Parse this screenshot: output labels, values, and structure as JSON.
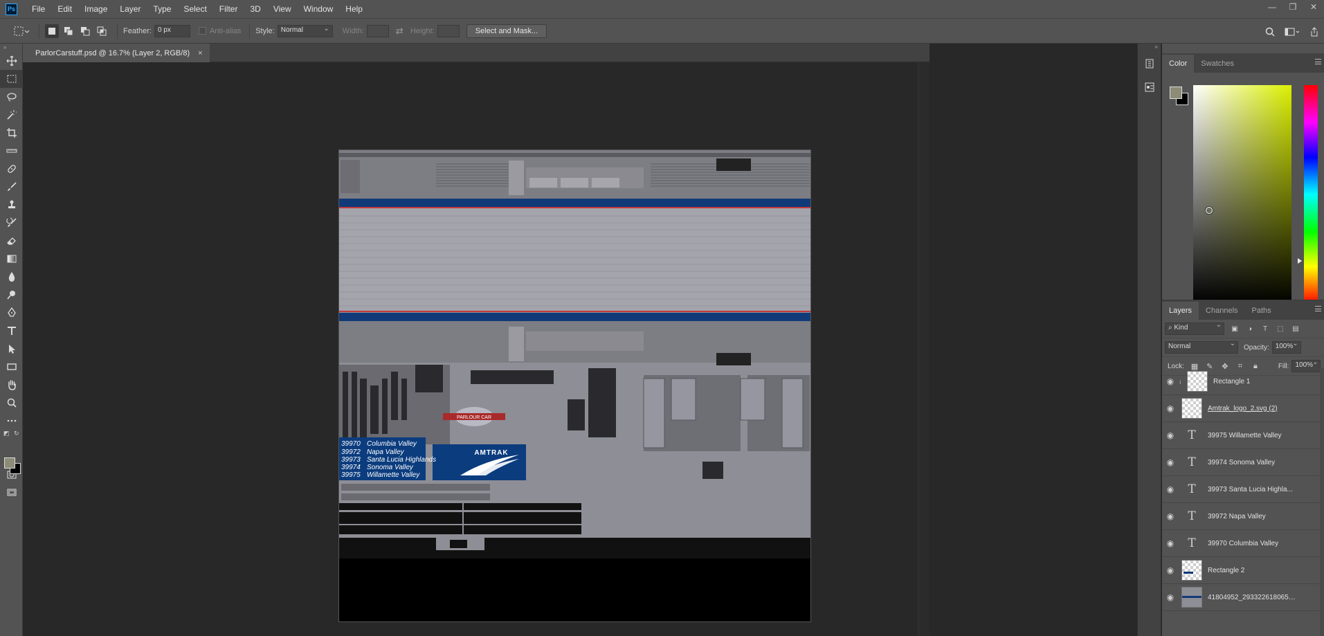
{
  "app": {
    "logo": "Ps"
  },
  "menu": [
    "File",
    "Edit",
    "Image",
    "Layer",
    "Type",
    "Select",
    "Filter",
    "3D",
    "View",
    "Window",
    "Help"
  ],
  "window_controls": {
    "minimize": "—",
    "restore": "❐",
    "close": "✕"
  },
  "options": {
    "feather_label": "Feather:",
    "feather_value": "0 px",
    "antialias_label": "Anti-alias",
    "style_label": "Style:",
    "style_value": "Normal",
    "width_label": "Width:",
    "height_label": "Height:",
    "select_mask_label": "Select and Mask..."
  },
  "document": {
    "tab_title": "ParlorCarstuff.psd @ 16.7% (Layer 2, RGB/8)",
    "tab_close": "×"
  },
  "texture": {
    "car_list": [
      {
        "number": "39970",
        "name": "Columbia Valley"
      },
      {
        "number": "39972",
        "name": "Napa Valley"
      },
      {
        "number": "39973",
        "name": "Santa Lucia Highlands"
      },
      {
        "number": "39974",
        "name": "Sonoma Valley"
      },
      {
        "number": "39975",
        "name": "Willamette Valley"
      }
    ],
    "brand": "AMTRAK",
    "emblem_text": "PARLOUR CAR",
    "colors": {
      "body": "#8e8e96",
      "blue_stripe": "#113a78",
      "red_stripe": "#c23a3a",
      "logo_blue": "#0b3c7e"
    }
  },
  "color_panel": {
    "tabs": [
      "Color",
      "Swatches"
    ],
    "foreground": "#8c8c77",
    "background": "#000000"
  },
  "layers_panel": {
    "tabs": [
      "Layers",
      "Channels",
      "Paths"
    ],
    "filter_kind": "Kind",
    "blend_mode": "Normal",
    "opacity_label": "Opacity:",
    "opacity_value": "100%",
    "lock_label": "Lock:",
    "fill_label": "Fill:",
    "fill_value": "100%",
    "layers": [
      {
        "name": "Rectangle 1",
        "type": "shape",
        "clipped": true
      },
      {
        "name": "Amtrak_logo_2.svg (2)",
        "type": "smart",
        "underline": true
      },
      {
        "name": "39975   Willamette Valley",
        "type": "text"
      },
      {
        "name": "39974   Sonoma Valley",
        "type": "text"
      },
      {
        "name": "39973   Santa Lucia Highla...",
        "type": "text"
      },
      {
        "name": "39972   Napa Valley",
        "type": "text"
      },
      {
        "name": "39970   Columbia Valley",
        "type": "text"
      },
      {
        "name": "Rectangle 2",
        "type": "shape"
      },
      {
        "name": "41804952_2933226180650...",
        "type": "image"
      }
    ]
  }
}
